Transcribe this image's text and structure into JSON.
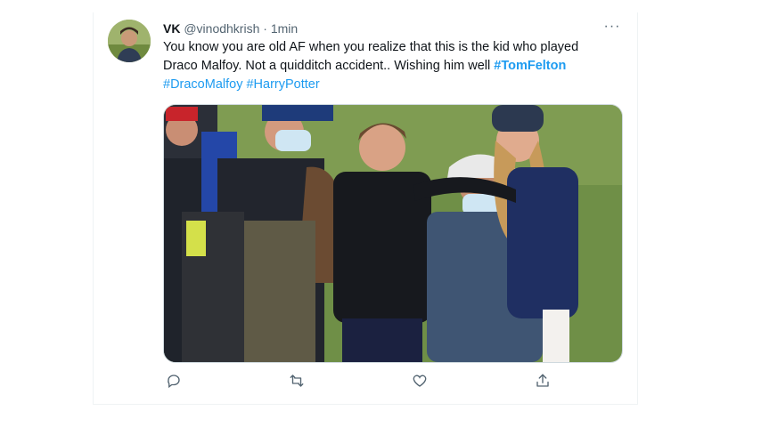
{
  "tweet": {
    "name": "VK",
    "handle": "@vinodhkrish",
    "separator": "·",
    "time": "1min",
    "text_line1": "You know you are old AF when you realize that this is the kid who played",
    "text_line2": "Draco Malfoy. Not a quidditch accident.. Wishing him well",
    "hashtag_1": "#TomFelton",
    "hashtag_2": "#DracoMalfoy",
    "hashtag_3": "#HarryPotter",
    "more_label": "···"
  },
  "colors": {
    "link": "#1d9bf0",
    "secondary_text": "#536471",
    "grass": "#6f8f47"
  },
  "icons": [
    "reply-icon",
    "retweet-icon",
    "like-icon",
    "share-icon"
  ]
}
